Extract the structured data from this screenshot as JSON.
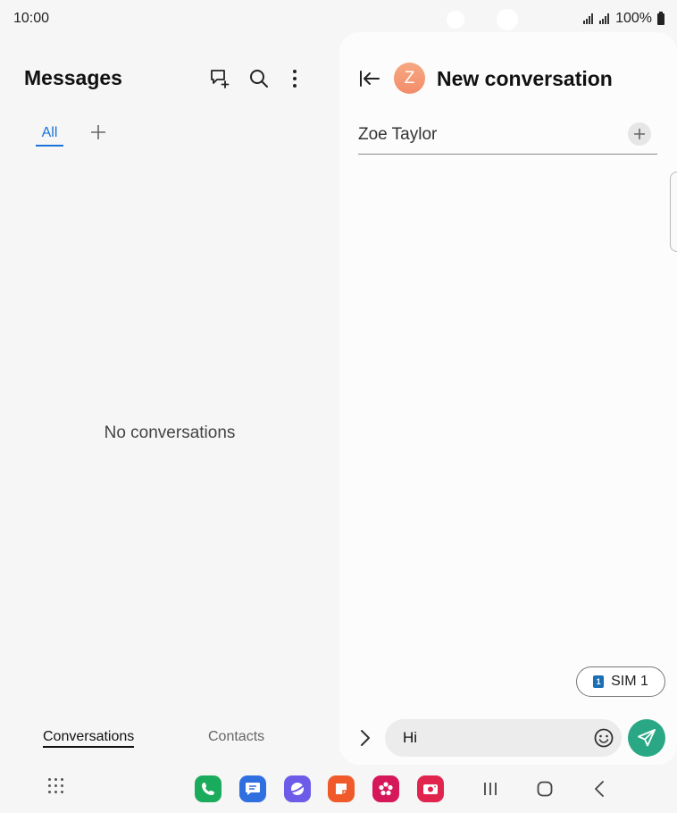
{
  "status_bar": {
    "time": "10:00",
    "battery": "100%"
  },
  "messages_panel": {
    "title": "Messages",
    "tabs": [
      {
        "label": "All",
        "active": true
      }
    ],
    "empty_text": "No conversations",
    "bottom_tabs": [
      {
        "label": "Conversations",
        "active": true
      },
      {
        "label": "Contacts",
        "active": false
      }
    ]
  },
  "conversation_panel": {
    "avatar_letter": "Z",
    "title": "New conversation",
    "recipient": "Zoe Taylor",
    "sim_label": "SIM 1",
    "sim_number": "1",
    "message_text": "Hi"
  },
  "colors": {
    "accent_blue": "#1a73d9",
    "send_green": "#2aa886",
    "avatar_orange": "#f48c6a"
  },
  "dock_apps": [
    {
      "icon": "phone-icon",
      "color": "#1bab5c"
    },
    {
      "icon": "messages-icon",
      "color": "#2f6fe0"
    },
    {
      "icon": "internet-icon",
      "color": "#6c5ce7"
    },
    {
      "icon": "notes-icon",
      "color": "#f05a2a"
    },
    {
      "icon": "gallery-icon",
      "color": "#d6175a"
    },
    {
      "icon": "camera-icon",
      "color": "#e0244e"
    }
  ]
}
